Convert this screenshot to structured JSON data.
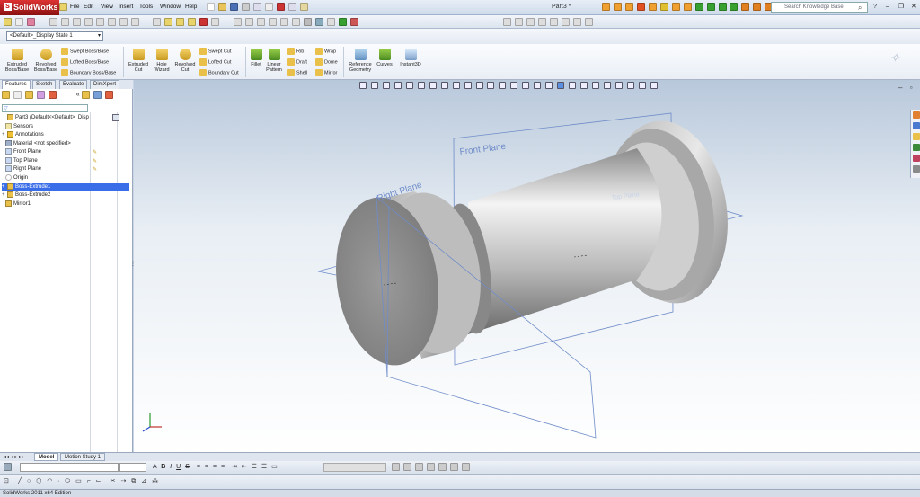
{
  "app": {
    "name": "SolidWorks",
    "document_title": "Part3 *"
  },
  "menu": [
    "File",
    "Edit",
    "View",
    "Insert",
    "Tools",
    "Window",
    "Help"
  ],
  "search": {
    "placeholder": "Search Knowledge Base"
  },
  "configuration": {
    "selected": "<Default>_Display State 1"
  },
  "command_manager": {
    "large": [
      {
        "label1": "Extruded",
        "label2": "Boss/Base",
        "icon": "extruded-boss-icon"
      },
      {
        "label1": "Revolved",
        "label2": "Boss/Base",
        "icon": "revolved-boss-icon"
      },
      {
        "label1": "Extruded",
        "label2": "Cut",
        "icon": "extruded-cut-icon"
      },
      {
        "label1": "Hole",
        "label2": "Wizard",
        "icon": "hole-wizard-icon"
      },
      {
        "label1": "Revolved",
        "label2": "Cut",
        "icon": "revolved-cut-icon"
      },
      {
        "label1": "Fillet",
        "label2": "",
        "icon": "fillet-icon"
      },
      {
        "label1": "Linear",
        "label2": "Pattern",
        "icon": "linear-pattern-icon"
      },
      {
        "label1": "Reference",
        "label2": "Geometry",
        "icon": "reference-geometry-icon"
      },
      {
        "label1": "Curves",
        "label2": "",
        "icon": "curves-icon"
      },
      {
        "label1": "Instant3D",
        "label2": "",
        "icon": "instant3d-icon"
      }
    ],
    "small": [
      {
        "label": "Swept Boss/Base"
      },
      {
        "label": "Lofted Boss/Base"
      },
      {
        "label": "Boundary Boss/Base"
      },
      {
        "label": "Swept Cut"
      },
      {
        "label": "Lofted Cut"
      },
      {
        "label": "Boundary Cut"
      },
      {
        "label": "Rib"
      },
      {
        "label": "Draft"
      },
      {
        "label": "Shell"
      },
      {
        "label": "Wrap"
      },
      {
        "label": "Dome"
      },
      {
        "label": "Mirror"
      }
    ]
  },
  "panel_tabs": [
    "Features",
    "Sketch",
    "Evaluate",
    "DimXpert"
  ],
  "feature_tree": [
    {
      "label": "Part3  (Default<<Default>_Disp",
      "icon": "part-icon",
      "expand": ""
    },
    {
      "label": "Sensors",
      "icon": "sensors-icon",
      "expand": ""
    },
    {
      "label": "Annotations",
      "icon": "annotations-icon",
      "expand": "+"
    },
    {
      "label": "Material <not specified>",
      "icon": "material-icon",
      "expand": ""
    },
    {
      "label": "Front Plane",
      "icon": "plane-icon",
      "expand": ""
    },
    {
      "label": "Top Plane",
      "icon": "plane-icon",
      "expand": ""
    },
    {
      "label": "Right Plane",
      "icon": "plane-icon",
      "expand": ""
    },
    {
      "label": "Origin",
      "icon": "origin-icon",
      "expand": ""
    },
    {
      "label": "Boss-Extrude1",
      "icon": "extrude-icon",
      "expand": "+",
      "selected": true
    },
    {
      "label": "Boss-Extrude2",
      "icon": "extrude-icon",
      "expand": "+"
    },
    {
      "label": "Mirror1",
      "icon": "mirror-icon",
      "expand": ""
    }
  ],
  "viewport": {
    "plane_labels": {
      "front": "Front Plane",
      "right": "Right Plane",
      "top": "Top Plane"
    },
    "colors": {
      "plane": "#6f8cc9",
      "model": "#9a9a9a"
    }
  },
  "bottom_tabs": [
    "Model",
    "Motion Study 1"
  ],
  "status": {
    "text": "SolidWorks 2011 x64 Edition"
  }
}
